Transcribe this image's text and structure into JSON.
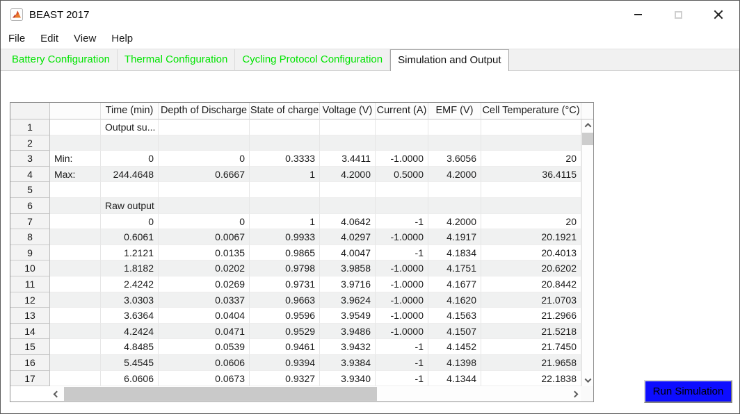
{
  "colors": {
    "tab_text_green": "#00e400",
    "run_button_blue": "#0d0dff"
  },
  "window": {
    "title": "BEAST 2017"
  },
  "menu": {
    "items": [
      "File",
      "Edit",
      "View",
      "Help"
    ]
  },
  "tabs": [
    {
      "label": "Battery Configuration",
      "active": false
    },
    {
      "label": "Thermal Configuration",
      "active": false
    },
    {
      "label": "Cycling Protocol Configuration",
      "active": false
    },
    {
      "label": "Simulation and Output",
      "active": true
    }
  ],
  "table": {
    "columns": [
      "",
      "",
      "Time (min)",
      "Depth of Discharge",
      "State of charge",
      "Voltage (V)",
      "Current (A)",
      "EMF (V)",
      "Cell Temperature (°C)"
    ],
    "rows": [
      [
        "1",
        "",
        "Output su...",
        "",
        "",
        "",
        "",
        "",
        ""
      ],
      [
        "2",
        "",
        "",
        "",
        "",
        "",
        "",
        "",
        ""
      ],
      [
        "3",
        "Min:",
        "0",
        "0",
        "0.3333",
        "3.4411",
        "-1.0000",
        "3.6056",
        "20"
      ],
      [
        "4",
        "Max:",
        "244.4648",
        "0.6667",
        "1",
        "4.2000",
        "0.5000",
        "4.2000",
        "36.4115"
      ],
      [
        "5",
        "",
        "",
        "",
        "",
        "",
        "",
        "",
        ""
      ],
      [
        "6",
        "",
        "Raw output",
        "",
        "",
        "",
        "",
        "",
        ""
      ],
      [
        "7",
        "",
        "0",
        "0",
        "1",
        "4.0642",
        "-1",
        "4.2000",
        "20"
      ],
      [
        "8",
        "",
        "0.6061",
        "0.0067",
        "0.9933",
        "4.0297",
        "-1.0000",
        "4.1917",
        "20.1921"
      ],
      [
        "9",
        "",
        "1.2121",
        "0.0135",
        "0.9865",
        "4.0047",
        "-1",
        "4.1834",
        "20.4013"
      ],
      [
        "10",
        "",
        "1.8182",
        "0.0202",
        "0.9798",
        "3.9858",
        "-1.0000",
        "4.1751",
        "20.6202"
      ],
      [
        "11",
        "",
        "2.4242",
        "0.0269",
        "0.9731",
        "3.9716",
        "-1.0000",
        "4.1677",
        "20.8442"
      ],
      [
        "12",
        "",
        "3.0303",
        "0.0337",
        "0.9663",
        "3.9624",
        "-1.0000",
        "4.1620",
        "21.0703"
      ],
      [
        "13",
        "",
        "3.6364",
        "0.0404",
        "0.9596",
        "3.9549",
        "-1.0000",
        "4.1563",
        "21.2966"
      ],
      [
        "14",
        "",
        "4.2424",
        "0.0471",
        "0.9529",
        "3.9486",
        "-1.0000",
        "4.1507",
        "21.5218"
      ],
      [
        "15",
        "",
        "4.8485",
        "0.0539",
        "0.9461",
        "3.9432",
        "-1",
        "4.1452",
        "21.7450"
      ],
      [
        "16",
        "",
        "5.4545",
        "0.0606",
        "0.9394",
        "3.9384",
        "-1",
        "4.1398",
        "21.9658"
      ],
      [
        "17",
        "",
        "6.0606",
        "0.0673",
        "0.9327",
        "3.9340",
        "-1",
        "4.1344",
        "22.1838"
      ]
    ]
  },
  "run_button": {
    "label": "Run Simulation"
  }
}
